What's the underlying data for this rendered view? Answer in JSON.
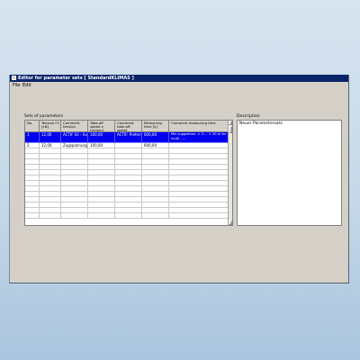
{
  "window": {
    "title": "Editor for parameter sets [ StandardKLIMAS ]"
  },
  "menu": [
    "File",
    "Edit"
  ],
  "parameter_sets": {
    "label": "Sets of parameters",
    "columns": [
      "No.",
      "Tension F1 [cN]",
      "Comment tension",
      "Take-off speed v [m/min]",
      "Comment take-off speed",
      "Measuring time [s]",
      "Comment measuring time"
    ],
    "rows": [
      [
        "1",
        "12,00",
        "ACTIF 02 : 0±0 N/m",
        "100,00",
        "ACTIF: Preferred v(…",
        "600,00",
        "Min suggestion: > 3 … > 30 m for multi - …"
      ],
      [
        "2",
        "12,00",
        "Zugspannung ent±f…",
        "100,00",
        "",
        "600,00",
        ""
      ]
    ],
    "selected_row": 0,
    "empty_rows": 13
  },
  "description": {
    "label": "Description",
    "text": "Neuer Parametersatz"
  }
}
